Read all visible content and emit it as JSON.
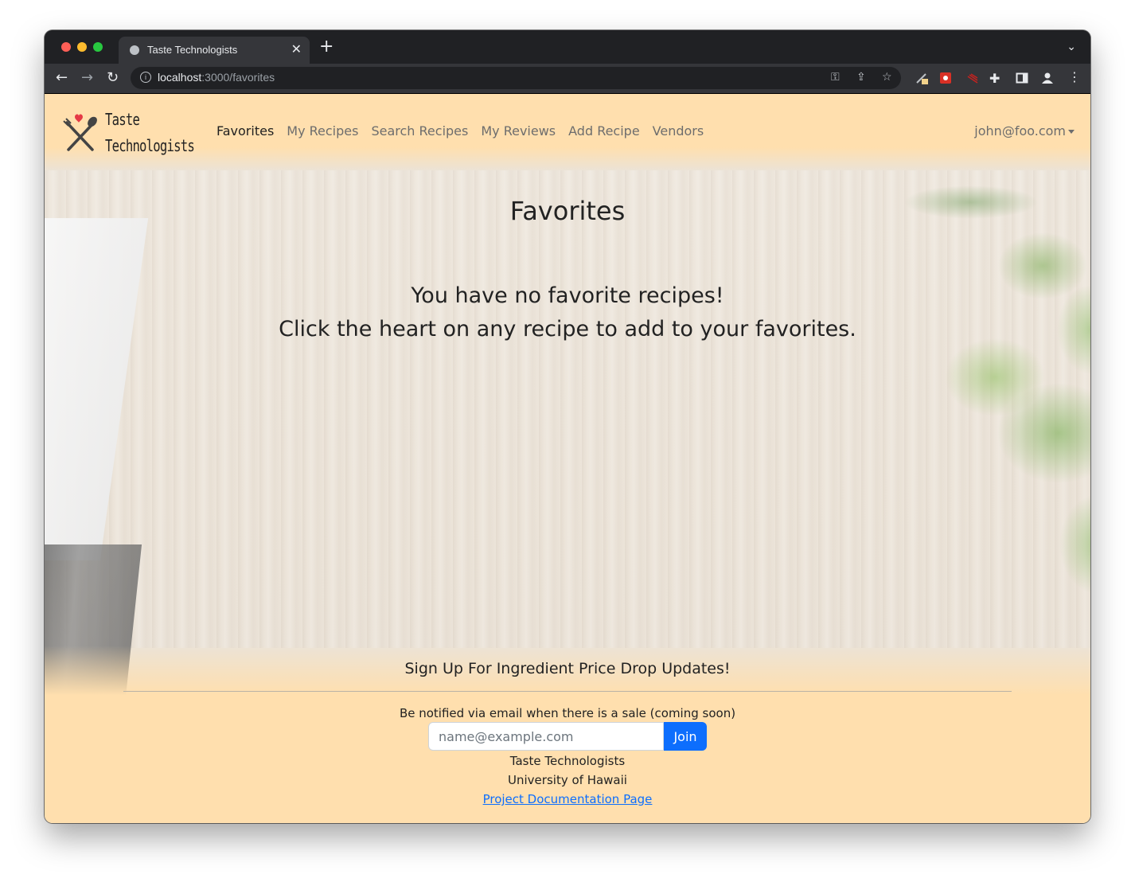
{
  "browser": {
    "tab_title": "Taste Technologists",
    "url_host": "localhost",
    "url_path": ":3000/favorites",
    "traffic_light_colors": [
      "#ff5f57",
      "#febc2e",
      "#28c840"
    ]
  },
  "navbar": {
    "brand_line1": "Taste",
    "brand_line2": "Technologists",
    "links": [
      "Favorites",
      "My Recipes",
      "Search Recipes",
      "My Reviews",
      "Add Recipe",
      "Vendors"
    ],
    "active_link": "Favorites",
    "user_email": "john@foo.com"
  },
  "main": {
    "title": "Favorites",
    "message_line1": "You have no favorite recipes!",
    "message_line2": "Click the heart on any recipe to add to your favorites."
  },
  "footer": {
    "title": "Sign Up For Ingredient Price Drop Updates!",
    "note": "Be notified via email when there is a sale (coming soon)",
    "email_placeholder": "name@example.com",
    "join_label": "Join",
    "org_name": "Taste Technologists",
    "university": "University of Hawaii",
    "doc_link": "Project Documentation Page"
  },
  "colors": {
    "navbar_bg": "#ffdfae",
    "join_button": "#0d6efd",
    "heart": "#e53945"
  }
}
